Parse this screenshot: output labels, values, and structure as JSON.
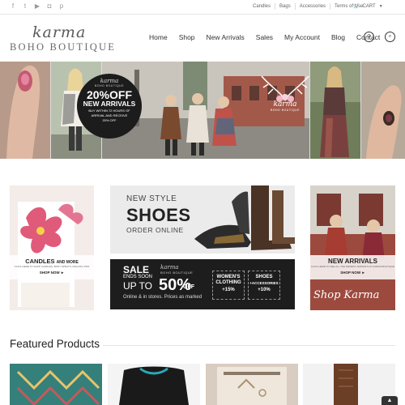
{
  "topbar": {
    "social_icons": [
      "facebook-icon",
      "twitter-icon",
      "youtube-icon",
      "instagram-icon",
      "pinterest-icon"
    ],
    "links": [
      "Candles",
      "Bags",
      "Accessories",
      "Terms of Use"
    ],
    "cart_label": "CART"
  },
  "header": {
    "logo_script": "karma",
    "logo_main": "BOHO BOUTIQUE",
    "nav": [
      "Home",
      "Shop",
      "New Arrivals",
      "Sales",
      "My Account",
      "Blog",
      "Contact"
    ]
  },
  "hero": {
    "badge": {
      "script": "karma",
      "small": "BOHO BOUTIQUE",
      "big": "20%OFF",
      "mid": "NEW ARRIVALS",
      "tiny1": "BUY WITHIN 72 HOURS OF",
      "tiny2": "ARRIVAL AND RECEIVE",
      "tiny3": "20% OFF"
    },
    "sign_script": "karma",
    "sign_small": "BOHO BOUTIQUE"
  },
  "promos": {
    "candles": {
      "title": "CANDLES",
      "title_suffix": "AND MORE",
      "sub": "CLICK HERE TO SHOP CANDLES, BODY SPRAYS, ROLLING TINS",
      "cta": "SHOP NOW ►"
    },
    "shoes": {
      "line1": "NEW STYLE",
      "line2": "SHOES",
      "line3": "ORDER ONLINE"
    },
    "sale": {
      "line1": "SALE",
      "line2": "ENDS SOON",
      "line3": "UP TO",
      "brand_script": "karma",
      "brand_small": "BOHO BOUTIQUE",
      "percent": "50%",
      "off": "OFF",
      "footer": "Online & in stores. Prices as marked",
      "box1_title1": "WOMEN'S",
      "box1_title2": "CLOTHING",
      "box1_value": "+15%",
      "box2_title1": "SHOES",
      "box2_title2": "+ACCESSORIES",
      "box2_value": "+10%"
    },
    "arrivals": {
      "title": "NEW ARRIVALS",
      "sub": "CLICK HERE TO SEE ALL THE NEWEST ARRIVALS AT KARMA BOUTIQUE",
      "cta": "SHOP NOW ►",
      "script": "Shop Karma"
    }
  },
  "featured": {
    "title": "Featured Products"
  },
  "colors": {
    "accent": "#222222",
    "topbar_border": "#e6e6e6",
    "sale_bg": "#1d1d1d"
  }
}
